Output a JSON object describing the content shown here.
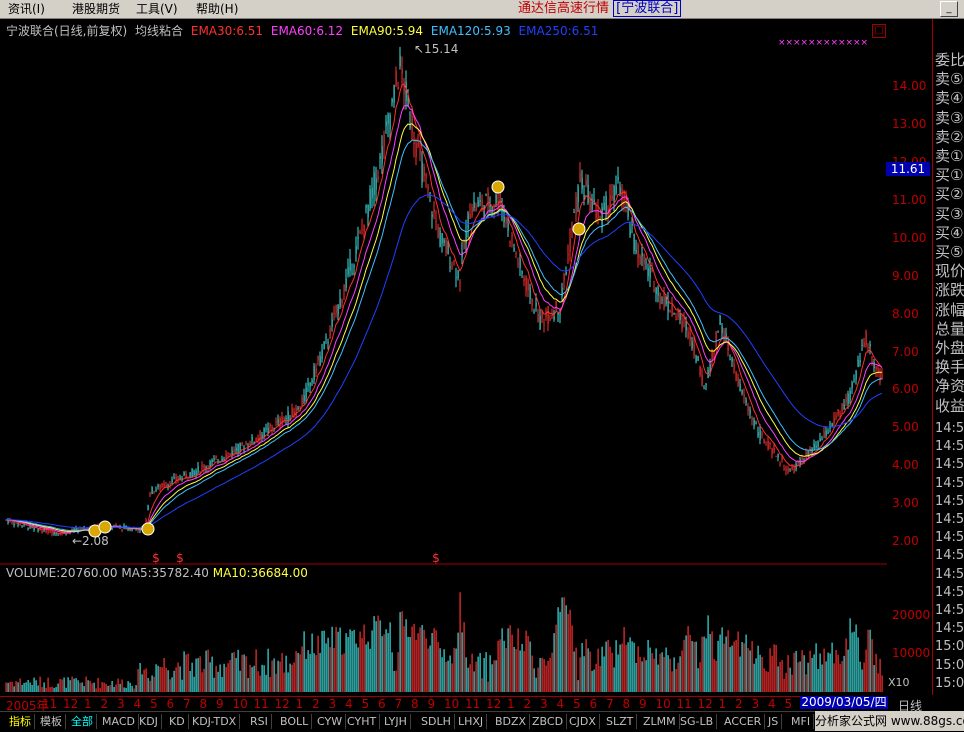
{
  "menu": {
    "items": [
      "资讯(I)",
      "港股期货",
      "工具(V)",
      "帮助(H)"
    ],
    "app_title": "通达信高速行情",
    "stock_name": "[宁波联合]"
  },
  "chart": {
    "header": "宁波联合(日线,前复权)",
    "indicator_name": "均线粘合",
    "ema": [
      {
        "label": "EMA30:6.51",
        "color": "#ff3030"
      },
      {
        "label": "EMA60:6.12",
        "color": "#ff40ff"
      },
      {
        "label": "EMA90:5.94",
        "color": "#ffff40"
      },
      {
        "label": "EMA120:5.93",
        "color": "#40c0ff"
      },
      {
        "label": "EMA250:6.51",
        "color": "#2040ff"
      }
    ],
    "price_ticks": [
      "14.00",
      "13.00",
      "12.00",
      "11.00",
      "10.00",
      "9.00",
      "8.00",
      "7.00",
      "6.00",
      "5.00",
      "4.00",
      "3.00",
      "2.00"
    ],
    "current_price": "11.61",
    "high_marker": "15.14",
    "low_marker": "2.08",
    "signal_marker": "$",
    "volume_legend": {
      "volume": "VOLUME:20760.00",
      "ma5": "MA5:35782.40",
      "ma10": "MA10:36684.00"
    },
    "volume_ticks": [
      "20000",
      "10000"
    ],
    "volume_multiplier": "X10",
    "x_labels": [
      "2005年",
      "11",
      "12",
      "1",
      "2",
      "3",
      "4",
      "5",
      "6",
      "7",
      "8",
      "9",
      "10",
      "11",
      "12",
      "1",
      "2",
      "3",
      "4",
      "5",
      "6",
      "7",
      "8",
      "9",
      "10",
      "11",
      "12",
      "1",
      "2",
      "3",
      "4",
      "5",
      "6",
      "7",
      "8",
      "9",
      "10",
      "11",
      "12",
      "1",
      "2",
      "3",
      "4",
      "5",
      "6",
      "7",
      "8",
      "9",
      "10"
    ],
    "current_date": "2009/03/05/四",
    "period": "日线"
  },
  "quote_panel": {
    "labels": [
      "委比",
      "卖⑤",
      "卖④",
      "卖③",
      "卖②",
      "卖①",
      "买①",
      "买②",
      "买③",
      "买④",
      "买⑤",
      "现价",
      "涨跌",
      "涨幅",
      "总量",
      "外盘",
      "换手",
      "净资",
      "收益"
    ],
    "times": [
      "14:5",
      "14:5",
      "14:5",
      "14:5",
      "14:5",
      "14:5",
      "14:5",
      "14:5",
      "14:5",
      "14:5",
      "14:5",
      "14:5",
      "15:0",
      "15:0",
      "15:0"
    ]
  },
  "tabs": {
    "mode_tabs": [
      "指标",
      "模板",
      "全部"
    ],
    "indicator_tabs": [
      "MACD",
      "KDJ",
      "KD",
      "KDJ-TDX",
      "RSI",
      "BOLL",
      "CYW",
      "CYHT",
      "LYJH",
      "SDLH",
      "LHXJ",
      "BDZX",
      "ZBCD",
      "CJDX",
      "SLZT",
      "ZLMM",
      "SG-LB",
      "ACCER",
      "JS",
      "MFI"
    ]
  },
  "watermark": "分析家公式网 www.88gs.com",
  "colors": {
    "up_candle": "#ff3030",
    "down_candle": "#40e0e0",
    "axis": "#a00000",
    "background": "#000000"
  }
}
